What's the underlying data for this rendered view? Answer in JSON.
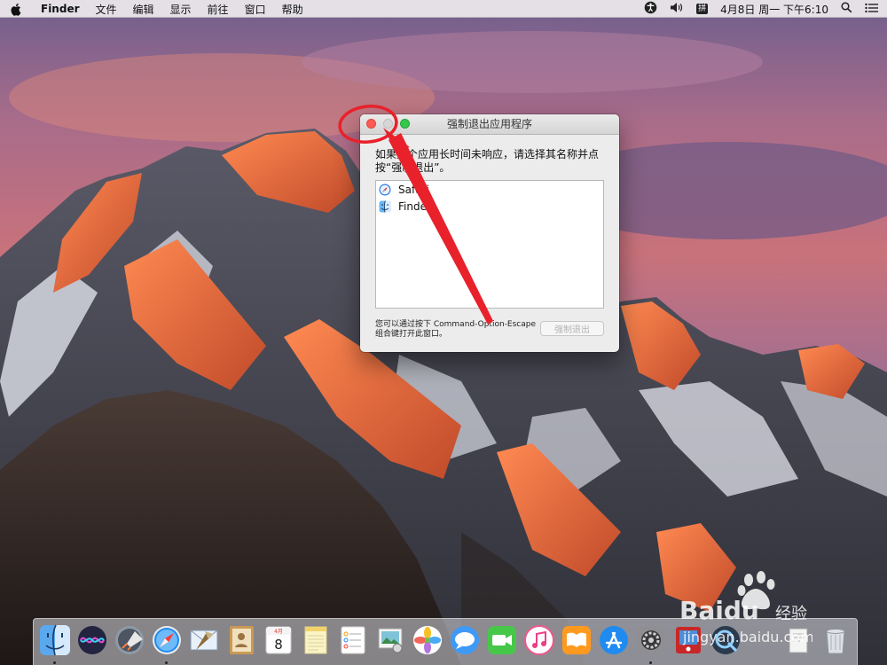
{
  "menubar": {
    "app_name": "Finder",
    "menus": [
      "文件",
      "编辑",
      "显示",
      "前往",
      "窗口",
      "帮助"
    ],
    "input_method": "拼",
    "datetime": "4月8日 周一 下午6:10",
    "icons": [
      "apple-icon",
      "accessibility-icon",
      "volume-icon",
      "search-icon",
      "notification-list-icon"
    ]
  },
  "force_quit": {
    "title": "强制退出应用程序",
    "description_line1": "如果某个应用长时间未响应，请选择其名称并点",
    "description_line2": "按“强制退出”。",
    "apps": [
      {
        "name": "Safari",
        "icon": "safari-compass-icon"
      },
      {
        "name": "Finder",
        "icon": "finder-face-icon"
      }
    ],
    "footer_line1": "您可以通过按下 Command-Option-Escape",
    "footer_line2": "组合键打开此窗口。",
    "button_label": "强制退出"
  },
  "dock": {
    "calendar_month": "4月",
    "calendar_day": "8",
    "items": [
      "finder-icon",
      "siri-icon",
      "launchpad-icon",
      "safari-icon",
      "mail-icon",
      "contacts-icon",
      "calendar-icon",
      "notes-icon",
      "reminders-icon",
      "preview-icon",
      "photos-icon",
      "messages-icon",
      "facetime-icon",
      "itunes-icon",
      "ibooks-icon",
      "app-store-icon",
      "system-preferences-icon",
      "photo-booth-icon",
      "quicktime-icon",
      "downloads-stack-icon",
      "trash-icon"
    ]
  },
  "watermark": {
    "brand": "Baidu",
    "brand_cn": "经验",
    "url": "jingyan.baidu.com"
  },
  "colors": {
    "close_red": "#fc5c55",
    "annotation_red": "#e8212b",
    "zoom_green": "#34c84a"
  }
}
